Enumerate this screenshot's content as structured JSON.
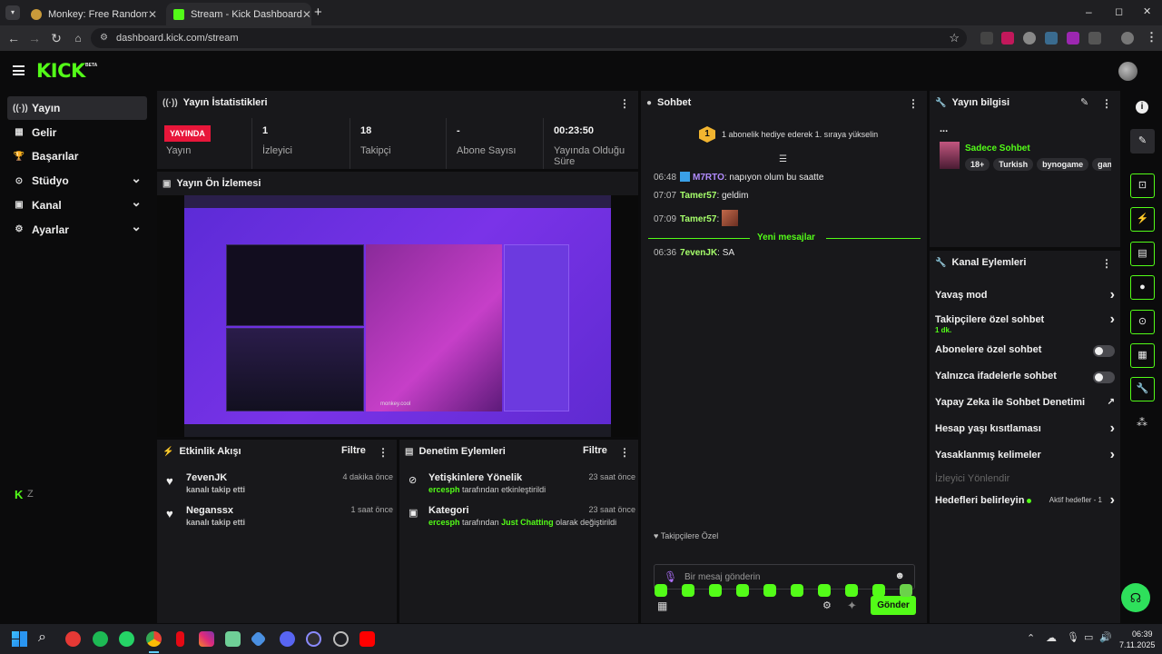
{
  "browser": {
    "tabs": [
      {
        "title": "Monkey: Free Random Vide",
        "active": false
      },
      {
        "title": "Stream - Kick Dashboard",
        "active": true
      }
    ],
    "new_tab": "+",
    "url": "dashboard.kick.com/stream",
    "window_controls": [
      "–",
      "◻",
      "✕"
    ]
  },
  "header": {
    "logo": "KICK",
    "logo_badge": "BETA"
  },
  "sidebar": {
    "items": [
      {
        "label": "Yayın",
        "icon": "broadcast-icon",
        "glyph": "((·))",
        "active": true,
        "chevron": false
      },
      {
        "label": "Gelir",
        "icon": "revenue-icon",
        "glyph": "▦",
        "active": false,
        "chevron": false
      },
      {
        "label": "Başarılar",
        "icon": "trophy-icon",
        "glyph": "🏆",
        "active": false,
        "chevron": false
      },
      {
        "label": "Stüdyo",
        "icon": "studio-icon",
        "glyph": "⊙",
        "active": false,
        "chevron": true
      },
      {
        "label": "Kanal",
        "icon": "channel-icon",
        "glyph": "▣",
        "active": false,
        "chevron": true
      },
      {
        "label": "Ayarlar",
        "icon": "settings-icon",
        "glyph": "⚙",
        "active": false,
        "chevron": true
      }
    ],
    "bottom_logo": "K",
    "bottom_badge": "Z"
  },
  "stats": {
    "title": "Yayın İstatistikleri",
    "live_badge": "YAYINDA",
    "live_label": "Yayın",
    "items": [
      {
        "value": "1",
        "label": "İzleyici"
      },
      {
        "value": "18",
        "label": "Takipçi"
      },
      {
        "value": "-",
        "label": "Abone Sayısı"
      },
      {
        "value": "00:23:50",
        "label": "Yayında Olduğu Süre"
      }
    ]
  },
  "preview": {
    "title": "Yayın Ön İzlemesi",
    "watermark": "monkey.cool"
  },
  "activity": {
    "title": "Etkinlik Akışı",
    "filter": "Filtre",
    "rows": [
      {
        "user": "7evenJK",
        "action": "kanalı takip etti",
        "time": "4 dakika önce"
      },
      {
        "user": "Neganssx",
        "action": "kanalı takip etti",
        "time": "1 saat önce"
      }
    ]
  },
  "moderation": {
    "title": "Denetim Eylemleri",
    "filter": "Filtre",
    "rows": [
      {
        "title": "Yetişkinlere Yönelik",
        "user": "ercesph",
        "rest": "tarafından etkinleştirildi",
        "time": "23 saat önce"
      },
      {
        "title": "Kategori",
        "user": "ercesph",
        "mid": "tarafından",
        "cat": "Just Chatting",
        "rest": "olarak değiştirildi",
        "time": "23 saat önce"
      }
    ]
  },
  "chat": {
    "title": "Sohbet",
    "gift_rank": "1",
    "gift_text": "1 abonelik hediye ederek 1. sıraya yükselin",
    "messages": [
      {
        "time": "06:48",
        "user": "M7RTO",
        "text": "napıyon olum bu saatte"
      },
      {
        "time": "07:07",
        "user": "Tamer57",
        "text": "geldim"
      },
      {
        "time": "07:09",
        "user": "Tamer57",
        "text": ""
      }
    ],
    "new_messages": "Yeni mesajlar",
    "after": [
      {
        "time": "06:36",
        "user": "7evenJK",
        "text": "SA"
      }
    ],
    "followers_only": "Takipçilere Özel",
    "input_placeholder": "Bir mesaj gönderin",
    "send": "Gönder"
  },
  "info": {
    "title": "Yayın bilgisi",
    "ellipsis": "...",
    "stream_title": "Sadece Sohbet",
    "tags": [
      "18+",
      "Turkish",
      "bynogame",
      "gaming"
    ]
  },
  "channel_actions": {
    "title": "Kanal Eylemleri",
    "rows": [
      {
        "label": "Yavaş mod",
        "type": "chevron"
      },
      {
        "label": "Takipçilere özel sohbet",
        "sub": "1 dk.",
        "type": "chevron"
      },
      {
        "label": "Abonelere özel sohbet",
        "type": "toggle"
      },
      {
        "label": "Yalnızca ifadelerle sohbet",
        "type": "toggle"
      },
      {
        "label": "Yapay Zeka ile Sohbet Denetimi",
        "type": "external"
      },
      {
        "label": "Hesap yaşı kısıtlaması",
        "type": "chevron"
      },
      {
        "label": "Yasaklanmış kelimeler",
        "type": "chevron"
      },
      {
        "label": "İzleyici Yönlendir",
        "type": "disabled"
      },
      {
        "label": "Hedefleri belirleyin",
        "extra": "Aktif hedefler - 1",
        "type": "chevron"
      }
    ]
  },
  "taskbar": {
    "time": "06:39",
    "date": "7.11.2025"
  },
  "colors": {
    "accent": "#53fc18",
    "live": "#e8163a",
    "panel": "#18181b",
    "bg": "#0b0b0c"
  }
}
